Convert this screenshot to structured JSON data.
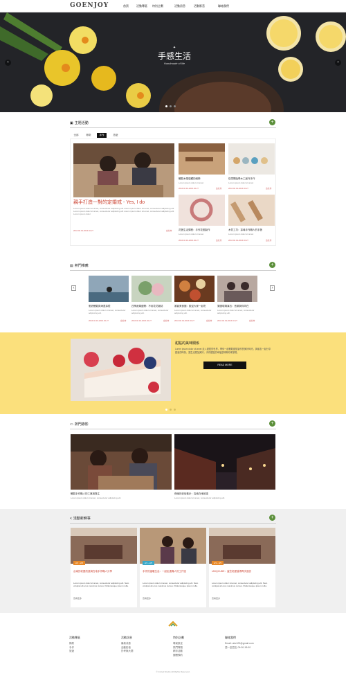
{
  "nav": {
    "logo": "GOENJOY",
    "items": [
      "首頁",
      "活動專區",
      "特別企劃",
      "活動訊息",
      "活動影音",
      "聯絡我們"
    ]
  },
  "hero": {
    "title": "手感生活",
    "subtitle": "Handmade of life"
  },
  "news": {
    "title": "主題活動",
    "tabs": [
      "全部",
      "節慶",
      "手作",
      "旅遊"
    ],
    "active_tab": "手作",
    "feature": {
      "title": "親手打造一對的定婚戒 - Yes, I do",
      "desc": "Lorem ipsum dolor sit amet, consectetur adipiscing elit Lorem ipsum dolor sit amet, consectetur adipiscing elit Lorem ipsum dolor sit amet, consectetur adipiscing elit Lorem ipsum dolor sit amet, consectetur adipiscing elit Lorem ipsum dolor",
      "date": "2016.02.19-2016.02.27",
      "loc": "台北市"
    },
    "items": [
      {
        "title": "體驗木頭感觸的細節",
        "desc": "Lorem ipsum dolor sit amet",
        "date": "2016.02.19-2016.02.27",
        "loc": "台北市"
      },
      {
        "title": "從零開始學木工創作手作",
        "desc": "Lorem ipsum dolor sit amet",
        "date": "2016.02.19-2016.02.27",
        "loc": "台北市"
      },
      {
        "title": "花藝生活課程：手作花圈製作",
        "desc": "Lorem ipsum dolor sit amet",
        "date": "2016.02.19-2016.02.27",
        "loc": "台北市"
      },
      {
        "title": "木質工坊：探尋手作職人的手藝",
        "desc": "Lorem ipsum dolor sit amet",
        "date": "2016.02.19-2016.02.27",
        "loc": "台北市"
      }
    ]
  },
  "popular": {
    "title": "熱門推薦",
    "items": [
      {
        "title": "衝浪體驗與海邊探險",
        "desc": "Lorem ipsum dolor sit amet, consectetur adipiscing elit.",
        "date": "2016.02.19-2016.02.27",
        "loc": "台北市"
      },
      {
        "title": "四季蔬果盛開：不用花花雜誌",
        "desc": "Lorem ipsum dolor sit amet, consectetur adipiscing elit.",
        "date": "2016.02.19-2016.02.27",
        "loc": "台北市"
      },
      {
        "title": "饕客美食團：歡迎大家一起吃",
        "desc": "Lorem ipsum dolor sit amet, consectetur adipiscing elit.",
        "date": "2016.02.19-2016.02.27",
        "loc": "台北市"
      },
      {
        "title": "樂團現場演出：音樂與你同在",
        "desc": "Lorem ipsum dolor sit amet, consectetur adipiscing elit.",
        "date": "2016.02.19-2016.02.27",
        "loc": "台北市"
      }
    ]
  },
  "promo": {
    "title": "甜點的美味關係",
    "desc": "Lorem ipsum dolor sit amet 走入甜點的世界，帶你一起體驗甜點製作的美好時光，與朋友一起分享甜蜜的時刻，讓生活更加美好，手作甜點的幸福滋味等你來發現。",
    "button": "READ MORE"
  },
  "video": {
    "title": "熱門錄影",
    "items": [
      {
        "title": "體驗手作職人的工藝與專注",
        "desc": "Lorem ipsum dolor sit amet, consectetur adipiscing elit."
      },
      {
        "title": "夜晚的老街散步：探索在地故事",
        "desc": "Lorem ipsum dolor sit amet, consectetur adipiscing elit."
      }
    ]
  },
  "share": {
    "title": "活動新鮮事",
    "items": [
      {
        "tag": "2/1 - 2/5",
        "title": "台南的老屋改造與在地手作職人分享",
        "body": "Lorem ipsum dolor sit amet, consectetur adipiscing elit. Nam volutpat ab eros maximus cursus. Pellentesque ipsum nulla.",
        "more": "查看更多"
      },
      {
        "tag": "2/1 - 2/5",
        "title": "手作的溫暖生活：一起走進職人的工作室",
        "body": "Lorem ipsum dolor sit amet, consectetur adipiscing elit. Nam volutpat ab eros maximus cursus. Pellentesque ipsum nulla.",
        "more": "查看更多"
      },
      {
        "tag": "2/1 - 2/5",
        "title": "UNIQCUBE：這些老屋值得再次造訪",
        "body": "Lorem ipsum dolor sit amet, consectetur adipiscing elit. Nam volutpat ab eros maximus cursus. Pellentesque ipsum nulla.",
        "more": "查看更多"
      }
    ]
  },
  "footer": {
    "cols": [
      {
        "title": "活動專區",
        "links": [
          "節慶",
          "手作",
          "旅遊"
        ]
      },
      {
        "title": "活動訊息",
        "links": [
          "最新消息",
          "活動影音",
          "於考無大閱"
        ]
      },
      {
        "title": "特別企劃",
        "links": [
          "專案設定",
          "熱門專題",
          "精彩活動",
          "團體預約"
        ]
      },
      {
        "title": "聯絡我們",
        "links": [
          "Email: abc123@gmail.com",
          "週一至週五 09:00-18:00"
        ]
      }
    ],
    "copyright": "© Invited Studio All Rights Reserved."
  }
}
